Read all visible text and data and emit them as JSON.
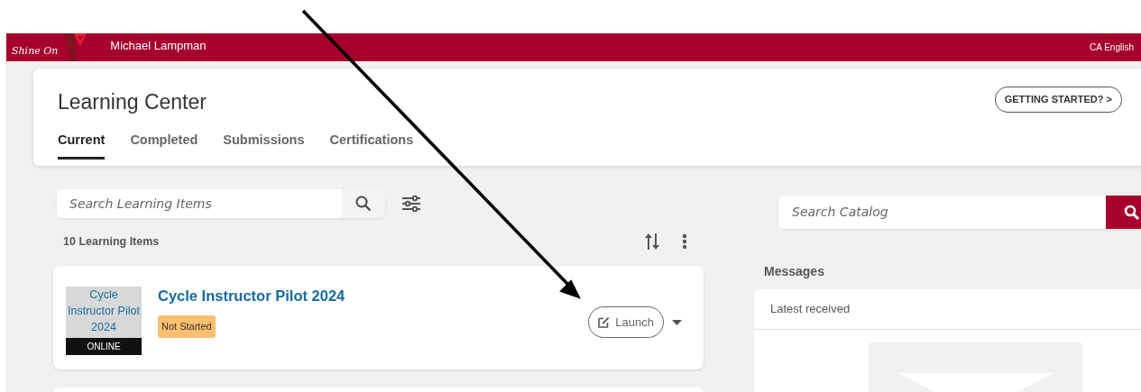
{
  "header": {
    "logo_text": "Shine On",
    "user_name": "Michael Lampman",
    "language": "CA English"
  },
  "learning_center": {
    "title": "Learning Center",
    "getting_started": "GETTING STARTED? >",
    "tabs": [
      {
        "label": "Current",
        "selected": true
      },
      {
        "label": "Completed",
        "selected": false
      },
      {
        "label": "Submissions",
        "selected": false
      },
      {
        "label": "Certifications",
        "selected": false
      }
    ]
  },
  "search": {
    "placeholder": "Search Learning Items"
  },
  "item_count": "10 Learning Items",
  "items": [
    {
      "title": "Cycle Instructor Pilot 2024",
      "thumbnail_alt": "Cycle Instructor Pilot 2024",
      "format": "ONLINE",
      "status": "Not Started",
      "action": "Launch"
    }
  ],
  "catalog_search": {
    "placeholder": "Search Catalog"
  },
  "messages": {
    "title": "Messages",
    "header": "Latest received"
  }
}
